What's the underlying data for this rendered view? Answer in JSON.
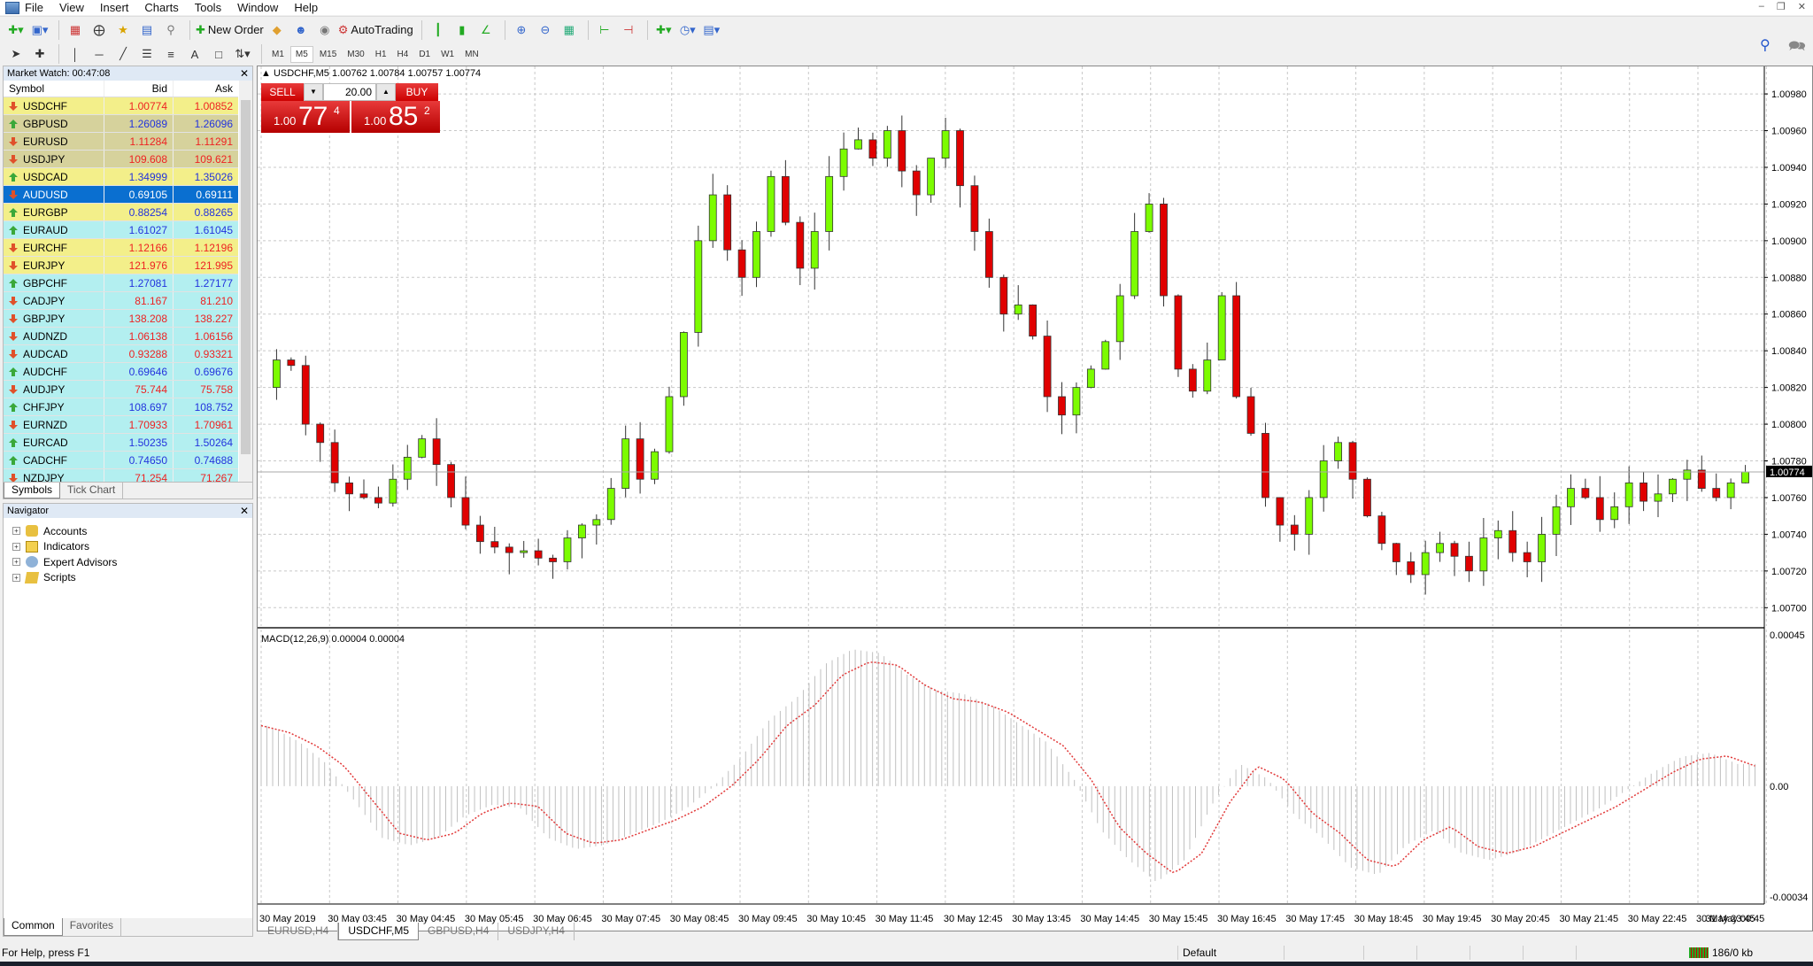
{
  "menubar": {
    "items": [
      "File",
      "View",
      "Insert",
      "Charts",
      "Tools",
      "Window",
      "Help"
    ]
  },
  "toolbar": {
    "new_order_label": "New Order",
    "autotrading_label": "AutoTrading",
    "timeframes": [
      "M1",
      "M5",
      "M15",
      "M30",
      "H1",
      "H4",
      "D1",
      "W1",
      "MN"
    ],
    "active_timeframe": "M5"
  },
  "market_watch": {
    "title": "Market Watch: 00:47:08",
    "columns": [
      "Symbol",
      "Bid",
      "Ask"
    ],
    "rows": [
      {
        "symbol": "USDCHF",
        "bid": "1.00774",
        "ask": "1.00852",
        "dir": "down",
        "bg": "yellow"
      },
      {
        "symbol": "GBPUSD",
        "bid": "1.26089",
        "ask": "1.26096",
        "dir": "up",
        "bg": "khaki"
      },
      {
        "symbol": "EURUSD",
        "bid": "1.11284",
        "ask": "1.11291",
        "dir": "down",
        "bg": "khaki"
      },
      {
        "symbol": "USDJPY",
        "bid": "109.608",
        "ask": "109.621",
        "dir": "down",
        "bg": "khaki"
      },
      {
        "symbol": "USDCAD",
        "bid": "1.34999",
        "ask": "1.35026",
        "dir": "up",
        "bg": "yellow"
      },
      {
        "symbol": "AUDUSD",
        "bid": "0.69105",
        "ask": "0.69111",
        "dir": "down",
        "bg": "selected"
      },
      {
        "symbol": "EURGBP",
        "bid": "0.88254",
        "ask": "0.88265",
        "dir": "up",
        "bg": "yellow"
      },
      {
        "symbol": "EURAUD",
        "bid": "1.61027",
        "ask": "1.61045",
        "dir": "up",
        "bg": "cyan"
      },
      {
        "symbol": "EURCHF",
        "bid": "1.12166",
        "ask": "1.12196",
        "dir": "down",
        "bg": "yellow"
      },
      {
        "symbol": "EURJPY",
        "bid": "121.976",
        "ask": "121.995",
        "dir": "down",
        "bg": "yellow"
      },
      {
        "symbol": "GBPCHF",
        "bid": "1.27081",
        "ask": "1.27177",
        "dir": "up",
        "bg": "cyan"
      },
      {
        "symbol": "CADJPY",
        "bid": "81.167",
        "ask": "81.210",
        "dir": "down",
        "bg": "cyan"
      },
      {
        "symbol": "GBPJPY",
        "bid": "138.208",
        "ask": "138.227",
        "dir": "down",
        "bg": "cyan"
      },
      {
        "symbol": "AUDNZD",
        "bid": "1.06138",
        "ask": "1.06156",
        "dir": "down",
        "bg": "cyan"
      },
      {
        "symbol": "AUDCAD",
        "bid": "0.93288",
        "ask": "0.93321",
        "dir": "down",
        "bg": "cyan"
      },
      {
        "symbol": "AUDCHF",
        "bid": "0.69646",
        "ask": "0.69676",
        "dir": "up",
        "bg": "cyan"
      },
      {
        "symbol": "AUDJPY",
        "bid": "75.744",
        "ask": "75.758",
        "dir": "down",
        "bg": "cyan"
      },
      {
        "symbol": "CHFJPY",
        "bid": "108.697",
        "ask": "108.752",
        "dir": "up",
        "bg": "cyan"
      },
      {
        "symbol": "EURNZD",
        "bid": "1.70933",
        "ask": "1.70961",
        "dir": "down",
        "bg": "cyan"
      },
      {
        "symbol": "EURCAD",
        "bid": "1.50235",
        "ask": "1.50264",
        "dir": "up",
        "bg": "cyan"
      },
      {
        "symbol": "CADCHF",
        "bid": "0.74650",
        "ask": "0.74688",
        "dir": "up",
        "bg": "cyan"
      },
      {
        "symbol": "NZDJPY",
        "bid": "71.254",
        "ask": "71.267",
        "dir": "down",
        "bg": "cyan"
      }
    ],
    "tabs": [
      "Symbols",
      "Tick Chart"
    ],
    "active_tab": "Symbols"
  },
  "navigator": {
    "title": "Navigator",
    "items": [
      "Accounts",
      "Indicators",
      "Expert Advisors",
      "Scripts"
    ],
    "tabs": [
      "Common",
      "Favorites"
    ],
    "active_tab": "Common"
  },
  "chart": {
    "info": "USDCHF,M5  1.00762 1.00784 1.00757 1.00774",
    "one_click": {
      "sell_label": "SELL",
      "buy_label": "BUY",
      "lot": "20.00",
      "sell_small": "1.00",
      "sell_big": "77",
      "sell_sup": "4",
      "buy_small": "1.00",
      "buy_big": "85",
      "buy_sup": "2"
    },
    "macd_label": "MACD(12,26,9) 0.00004 0.00004",
    "current_price": "1.00774",
    "tabs": [
      "EURUSD,H4",
      "USDCHF,M5",
      "GBPUSD,H4",
      "USDJPY,H4"
    ],
    "active_tab": "USDCHF,M5"
  },
  "chart_data": {
    "type": "candlestick",
    "symbol": "USDCHF",
    "timeframe": "M5",
    "price_axis": {
      "ticks": [
        "1.00980",
        "1.00960",
        "1.00940",
        "1.00920",
        "1.00900",
        "1.00880",
        "1.00860",
        "1.00840",
        "1.00820",
        "1.00800",
        "1.00780",
        "1.00760",
        "1.00740",
        "1.00720",
        "1.00700"
      ],
      "range": [
        1.0069,
        1.00995
      ]
    },
    "macd_axis": {
      "ticks": [
        "0.00045",
        "0.00",
        "-0.00034"
      ],
      "range": [
        -0.00034,
        0.00045
      ]
    },
    "time_ticks": [
      "30 May 2019",
      "30 May 03:45",
      "30 May 04:45",
      "30 May 05:45",
      "30 May 06:45",
      "30 May 07:45",
      "30 May 08:45",
      "30 May 09:45",
      "30 May 10:45",
      "30 May 11:45",
      "30 May 12:45",
      "30 May 13:45",
      "30 May 14:45",
      "30 May 15:45",
      "30 May 16:45",
      "30 May 17:45",
      "30 May 18:45",
      "30 May 19:45",
      "30 May 20:45",
      "30 May 21:45",
      "30 May 22:45",
      "30 May 23:45",
      "31 May 00:45"
    ],
    "close_path": [
      1.0082,
      1.00835,
      1.00832,
      1.008,
      1.0079,
      1.00768,
      1.00762,
      1.0076,
      1.00757,
      1.0077,
      1.00782,
      1.00792,
      1.00778,
      1.0076,
      1.00745,
      1.00736,
      1.00733,
      1.0073,
      1.00731,
      1.00727,
      1.00725,
      1.00738,
      1.00745,
      1.00748,
      1.00765,
      1.00792,
      1.0077,
      1.00785,
      1.00815,
      1.0085,
      1.009,
      1.00925,
      1.00895,
      1.0088,
      1.00905,
      1.00935,
      1.0091,
      1.00885,
      1.00905,
      1.00935,
      1.0095,
      1.00955,
      1.00945,
      1.0096,
      1.00938,
      1.00925,
      1.00945,
      1.0096,
      1.0093,
      1.00905,
      1.0088,
      1.0086,
      1.00865,
      1.00848,
      1.00815,
      1.00805,
      1.0082,
      1.0083,
      1.00845,
      1.0087,
      1.00905,
      1.0092,
      1.0087,
      1.0083,
      1.00818,
      1.00835,
      1.0087,
      1.00815,
      1.00795,
      1.0076,
      1.00745,
      1.0074,
      1.0076,
      1.0078,
      1.0079,
      1.0077,
      1.0075,
      1.00735,
      1.00725,
      1.00718,
      1.0073,
      1.00735,
      1.00728,
      1.0072,
      1.00738,
      1.00742,
      1.0073,
      1.00725,
      1.0074,
      1.00755,
      1.00765,
      1.0076,
      1.00748,
      1.00755,
      1.00768,
      1.00758,
      1.00762,
      1.0077,
      1.00775,
      1.00765,
      1.0076,
      1.00768,
      1.00774
    ],
    "macd_signal_path": [
      0.00018,
      0.00016,
      0.00012,
      6e-05,
      -4e-05,
      -0.00014,
      -0.00016,
      -0.00014,
      -8e-05,
      -5e-05,
      -6e-05,
      -0.00014,
      -0.00017,
      -0.00016,
      -0.00013,
      -0.0001,
      -6e-05,
      0.0,
      8e-05,
      0.00018,
      0.00024,
      0.00033,
      0.00037,
      0.00036,
      0.0003,
      0.00026,
      0.00025,
      0.00022,
      0.00017,
      0.00012,
      2e-05,
      -0.00012,
      -0.0002,
      -0.00026,
      -0.0002,
      -5e-05,
      6e-05,
      2e-05,
      -8e-05,
      -0.00014,
      -0.00022,
      -0.00024,
      -0.00016,
      -0.00012,
      -0.00018,
      -0.0002,
      -0.00018,
      -0.00014,
      -0.0001,
      -6e-05,
      -1e-05,
      4e-05,
      8e-05,
      9e-05,
      6e-05
    ]
  },
  "status": {
    "help": "For Help, press F1",
    "profile": "Default",
    "traffic": "186/0 kb"
  }
}
